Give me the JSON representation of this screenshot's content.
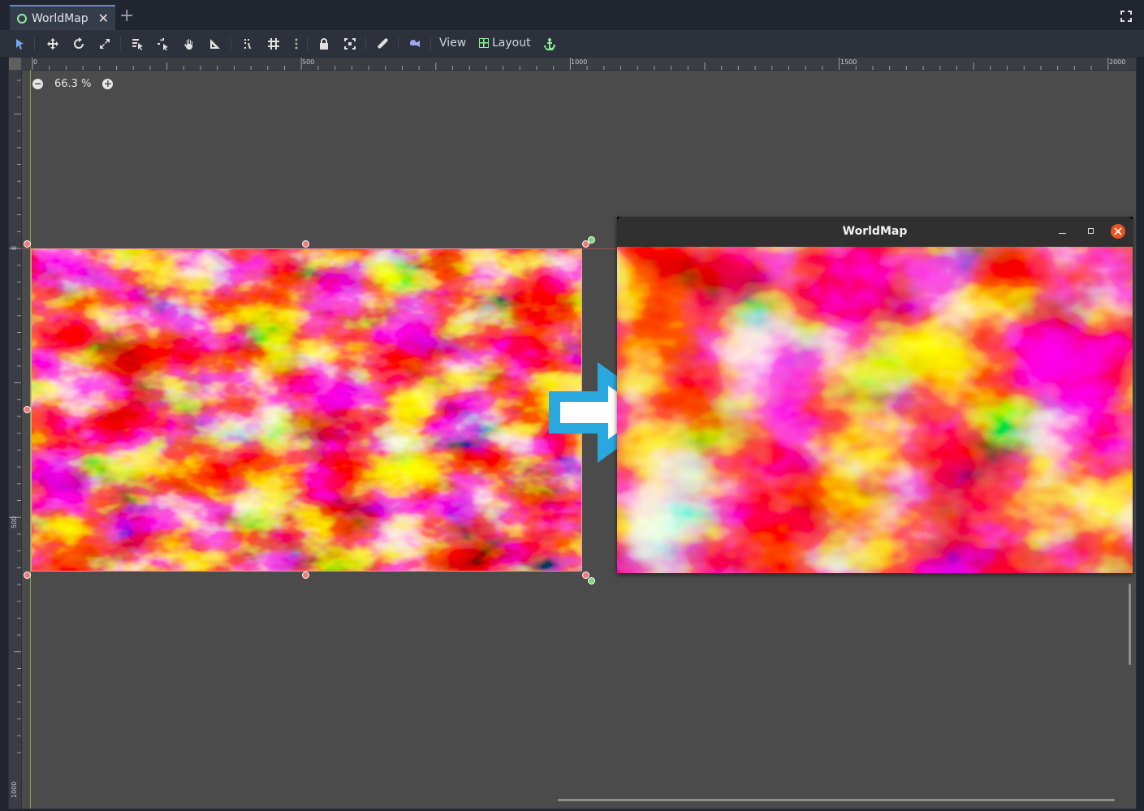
{
  "tab": {
    "title": "WorldMap",
    "close_glyph": "✕",
    "add_glyph": "+"
  },
  "toolbar": {
    "view_label": "View",
    "layout_label": "Layout"
  },
  "viewport": {
    "zoom": "66.3 %",
    "zoom_out_glyph": "−",
    "zoom_in_glyph": "+",
    "ruler_h_labels": [
      "0",
      "500",
      "1000",
      "1500",
      "2000"
    ],
    "ruler_v_labels": [
      "0",
      "500",
      "1000"
    ]
  },
  "game_window": {
    "title": "WorldMap"
  },
  "colors": {
    "accent": "#5a8dd6",
    "node_green": "#8eef97",
    "selection_handle": "#f07a7a",
    "arrow_fill": "#29a8e0",
    "close_button": "#e95420"
  },
  "icons": [
    "select-icon",
    "move-icon",
    "rotate-icon",
    "scale-icon",
    "list-select-icon",
    "pivot-icon",
    "pan-icon",
    "ruler-icon",
    "smart-snap-icon",
    "grid-snap-icon",
    "more-icon",
    "lock-icon",
    "group-icon",
    "bone-icon",
    "camera-icon",
    "layout-grid-icon",
    "anchor-icon",
    "distraction-free-icon"
  ]
}
